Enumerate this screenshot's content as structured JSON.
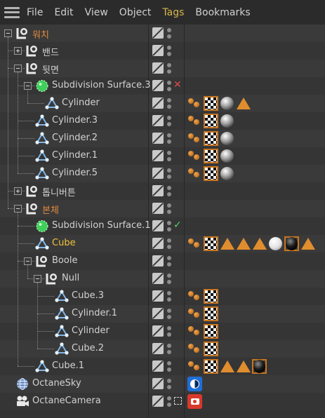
{
  "menu": {
    "items": [
      {
        "label": "File",
        "active": false
      },
      {
        "label": "Edit",
        "active": false
      },
      {
        "label": "View",
        "active": false
      },
      {
        "label": "Object",
        "active": false
      },
      {
        "label": "Tags",
        "active": true
      },
      {
        "label": "Bookmarks",
        "active": false
      }
    ]
  },
  "colors": {
    "background": "#333333",
    "menubar": "#2b2b2b",
    "null_label": "#e08a3e",
    "selected_label": "#f0c23c",
    "default_label": "#d2d2d2",
    "tag_orange": "#c8761f"
  },
  "objects": [
    {
      "name": "워치",
      "icon": "null-object-icon",
      "depth": 0,
      "expander": "minus",
      "color": "orange",
      "status": "",
      "tags": []
    },
    {
      "name": "밴드",
      "icon": "null-object-icon",
      "depth": 1,
      "expander": "plus",
      "color": "",
      "status": "",
      "tags": []
    },
    {
      "name": "뒷면",
      "icon": "null-object-icon",
      "depth": 1,
      "expander": "minus",
      "color": "",
      "status": "",
      "tags": []
    },
    {
      "name": "Subdivision Surface.3",
      "icon": "subdivision-surface-icon",
      "depth": 2,
      "expander": "minus",
      "color": "",
      "status": "disabled",
      "tags": []
    },
    {
      "name": "Cylinder",
      "icon": "cylinder-icon",
      "depth": 3,
      "expander": "",
      "color": "",
      "status": "",
      "tags": [
        "texture-balls-tag-icon",
        "checker-material-tag-icon",
        "metal-sphere-tag-icon",
        "selection-tag-icon"
      ]
    },
    {
      "name": "Cylinder.3",
      "icon": "cylinder-icon",
      "depth": 2,
      "expander": "",
      "color": "",
      "status": "",
      "tags": [
        "texture-balls-tag-icon",
        "checker-material-tag-icon",
        "metal-sphere-tag-icon"
      ]
    },
    {
      "name": "Cylinder.2",
      "icon": "cylinder-icon",
      "depth": 2,
      "expander": "",
      "color": "",
      "status": "",
      "tags": [
        "texture-balls-tag-icon",
        "checker-material-tag-icon",
        "metal-sphere-tag-icon"
      ]
    },
    {
      "name": "Cylinder.1",
      "icon": "cylinder-icon",
      "depth": 2,
      "expander": "",
      "color": "",
      "status": "",
      "tags": [
        "texture-balls-tag-icon",
        "checker-material-tag-icon",
        "metal-sphere-tag-icon"
      ]
    },
    {
      "name": "Cylinder.5",
      "icon": "cylinder-icon",
      "depth": 2,
      "expander": "",
      "color": "",
      "status": "",
      "tags": [
        "texture-balls-tag-icon",
        "checker-material-tag-icon",
        "metal-sphere-tag-icon"
      ]
    },
    {
      "name": "톱니버튼",
      "icon": "null-object-icon",
      "depth": 1,
      "expander": "plus",
      "color": "",
      "status": "",
      "tags": []
    },
    {
      "name": "본체",
      "icon": "null-object-icon",
      "depth": 1,
      "expander": "minus",
      "color": "orange",
      "status": "",
      "tags": []
    },
    {
      "name": "Subdivision Surface.1",
      "icon": "subdivision-surface-icon",
      "depth": 2,
      "expander": "",
      "color": "",
      "status": "enabled",
      "tags": []
    },
    {
      "name": "Cube",
      "icon": "cube-icon",
      "depth": 2,
      "expander": "",
      "color": "yellow",
      "status": "",
      "tags": [
        "texture-balls-tag-icon",
        "checker-material-tag-icon",
        "selection-tag-icon",
        "selection-tag-icon",
        "selection-tag-icon",
        "white-sphere-tag-icon",
        "black-sphere-tag-icon",
        "selection-tag-icon"
      ]
    },
    {
      "name": "Boole",
      "icon": "null-object-icon",
      "depth": 2,
      "expander": "minus",
      "color": "",
      "status": "",
      "tags": []
    },
    {
      "name": "Null",
      "icon": "null-object-icon",
      "depth": 3,
      "expander": "minus",
      "color": "",
      "status": "",
      "tags": []
    },
    {
      "name": "Cube.3",
      "icon": "cube-icon",
      "depth": 4,
      "expander": "",
      "color": "",
      "status": "",
      "tags": [
        "texture-balls-tag-icon",
        "checker-material-tag-icon"
      ]
    },
    {
      "name": "Cylinder.1",
      "icon": "cylinder-icon",
      "depth": 4,
      "expander": "",
      "color": "",
      "status": "",
      "tags": [
        "texture-balls-tag-icon",
        "checker-material-tag-icon"
      ]
    },
    {
      "name": "Cylinder",
      "icon": "cylinder-icon",
      "depth": 4,
      "expander": "",
      "color": "",
      "status": "",
      "tags": [
        "texture-balls-tag-icon",
        "checker-material-tag-icon"
      ]
    },
    {
      "name": "Cube.2",
      "icon": "cube-icon",
      "depth": 4,
      "expander": "",
      "color": "",
      "status": "",
      "tags": [
        "texture-balls-tag-icon",
        "checker-material-tag-icon"
      ]
    },
    {
      "name": "Cube.1",
      "icon": "cube-icon",
      "depth": 2,
      "expander": "",
      "color": "",
      "status": "",
      "tags": [
        "texture-balls-tag-icon",
        "checker-material-tag-icon",
        "selection-tag-icon",
        "selection-tag-icon",
        "black-sphere-tag-icon"
      ]
    },
    {
      "name": "OctaneSky",
      "icon": "globe-icon",
      "depth": 0,
      "expander": "",
      "color": "",
      "status": "",
      "tags": [
        "octane-sky-tag-icon"
      ]
    },
    {
      "name": "OctaneCamera",
      "icon": "camera-icon",
      "depth": 0,
      "expander": "",
      "color": "",
      "status": "target",
      "tags": [
        "octane-camera-tag-icon"
      ]
    }
  ]
}
